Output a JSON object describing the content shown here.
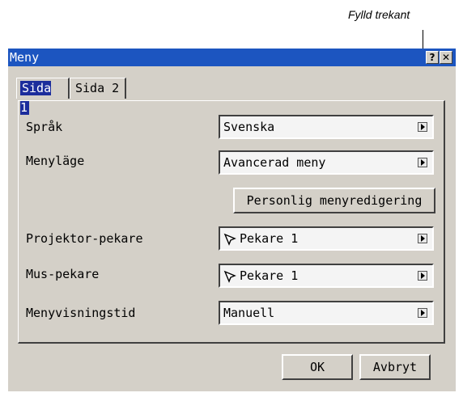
{
  "annotation": {
    "label": "Fylld trekant"
  },
  "window": {
    "title": "Meny",
    "help_label": "?",
    "close_label": "✕"
  },
  "tabs": [
    {
      "label": "Sida 1",
      "active": true
    },
    {
      "label": "Sida 2",
      "active": false
    }
  ],
  "settings": {
    "language": {
      "label": "Språk",
      "value": "Svenska"
    },
    "menu_mode": {
      "label": "Menyläge",
      "value": "Avancerad meny"
    },
    "custom_menu_button": "Personlig menyredigering",
    "projector_pointer": {
      "label": "Projektor-pekare",
      "value": "Pekare 1",
      "icon": "arrow-pointer-icon"
    },
    "mouse_pointer": {
      "label": "Mus-pekare",
      "value": "Pekare 1",
      "icon": "arrow-pointer-icon"
    },
    "menu_display_time": {
      "label": "Menyvisningstid",
      "value": "Manuell"
    }
  },
  "footer": {
    "ok_label": "OK",
    "cancel_label": "Avbryt"
  },
  "colors": {
    "titlebar": "#1c55c0",
    "dialog_bg": "#d4d0c8",
    "selected_tab": "#1c2d9c"
  }
}
